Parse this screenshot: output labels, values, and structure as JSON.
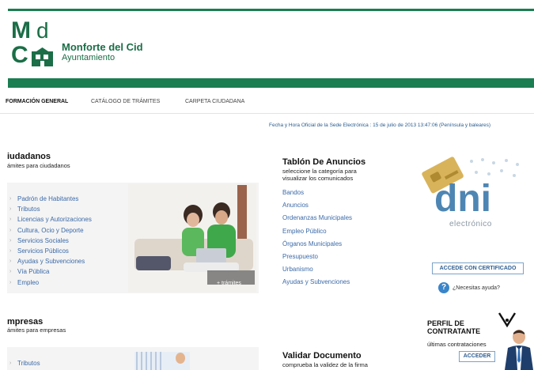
{
  "logo": {
    "m": "M",
    "d": "d",
    "c": "C"
  },
  "brand": {
    "name": "Monforte del Cid",
    "subtitle": "Ayuntamiento"
  },
  "nav": {
    "items": [
      "FORMACIÓN GENERAL",
      "CATÁLOGO DE TRÁMITES",
      "CARPETA CIUDADANA"
    ]
  },
  "datetime": "Fecha y Hora Oficial de la Sede Electrónica : 15 de julio de 2013 13:47:06 (Península y baleares)",
  "ciudadanos": {
    "title": "iudadanos",
    "subtitle": "ámites para ciudadanos",
    "items": [
      "Padrón de Habitantes",
      "Tributos",
      "Licencias y Autorizaciones",
      "Cultura, Ocio y Deporte",
      "Servicios Sociales",
      "Servicios Públicos",
      "Ayudas y Subvenciones",
      "Vía Pública",
      "Empleo"
    ],
    "photo_link": "+ trámites"
  },
  "empresas": {
    "title": "mpresas",
    "subtitle": "ámites para empresas",
    "items": [
      "Tributos"
    ]
  },
  "tablon": {
    "title": "Tablón De Anuncios",
    "subtitle_1": "seleccione la categoría para",
    "subtitle_2": "visualizar los comunicados",
    "items": [
      "Bandos",
      "Anuncios",
      "Ordenanzas Municipales",
      "Empleo Público",
      "Órganos Municipales",
      "Presupuesto",
      "Urbanismo",
      "Ayudas y Subvenciones"
    ]
  },
  "validar": {
    "title": "Validar Documento",
    "subtitle": "comprueba la validez de la firma"
  },
  "dni": {
    "word": "dni",
    "sub": "electrónico",
    "cert_button": "ACCEDE CON CERTIFICADO",
    "help_icon": "?",
    "help_text": "¿Necesitas ayuda?"
  },
  "perfil": {
    "title_1": "PERFIL DE",
    "title_2": "CONTRATANTE",
    "subtitle": "últimas contrataciones",
    "button": "ACCEDER"
  },
  "colors": {
    "brand_green": "#1b7d52",
    "link_blue": "#3b6aa8",
    "dni_blue": "#4e86b3"
  }
}
